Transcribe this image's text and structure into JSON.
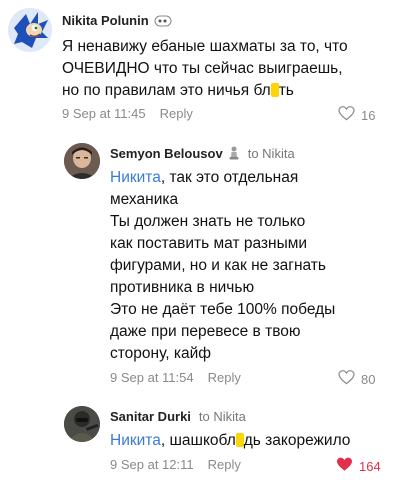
{
  "comments": [
    {
      "author": "Nikita Polunin",
      "to_prefix": "",
      "to": "",
      "lines": [
        "Я ненавижу ебаные шахматы за то, что",
        "ОЧЕВИДНО что ты сейчас выиграешь,"
      ],
      "last_line_a": "но по правилам это ничья бл",
      "last_line_b": "ть",
      "date": "9 Sep at 11:45",
      "reply": "Reply",
      "likes": "16",
      "avatar_icon": "sonic-avatar",
      "badge_icon": "pill-emoji"
    },
    {
      "author": "Semyon Belousov",
      "to_prefix": "to",
      "to": "Nikita",
      "mention": "Никита",
      "first_rest": ", так это отдельная",
      "lines": [
        "механика",
        "Ты должен знать не только",
        "как поставить мат разными",
        "фигурами, но и как не загнать",
        "противника в ничью",
        "Это не даёт тебе 100% победы",
        "даже при перевесе в твою",
        "сторону, кайф"
      ],
      "date": "9 Sep at 11:54",
      "reply": "Reply",
      "likes": "80",
      "avatar_icon": "man-avatar",
      "badge_icon": "chess-pawn-emoji"
    },
    {
      "author": "Sanitar Durki",
      "to_prefix": "to",
      "to": "Nikita",
      "mention": "Никита",
      "first_rest_a": ", шашкобл",
      "first_rest_b": "дь закорежило",
      "date": "9 Sep at 12:11",
      "reply": "Reply",
      "likes": "164",
      "liked": true,
      "accent": "#e0304a",
      "mention_color": "#3a7bd5",
      "avatar_icon": "soldier-avatar"
    }
  ]
}
